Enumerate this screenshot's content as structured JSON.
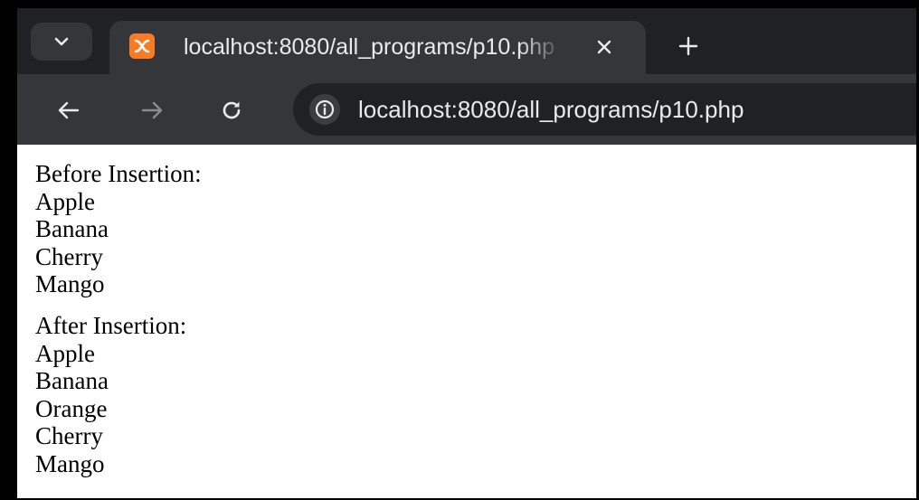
{
  "browser": {
    "tab": {
      "title": "localhost:8080/all_programs/p10.php",
      "favicon": "xampp-icon",
      "favicon_color": "#fb7a24"
    },
    "toolbar": {
      "url": "localhost:8080/all_programs/p10.php"
    },
    "colors": {
      "tabstrip_bg": "#202124",
      "toolbar_bg": "#35363a",
      "text": "#e8eaed"
    }
  },
  "page": {
    "before_heading": "Before Insertion:",
    "before_items": [
      "Apple",
      "Banana",
      "Cherry",
      "Mango"
    ],
    "after_heading": "After Insertion:",
    "after_items": [
      "Apple",
      "Banana",
      "Orange",
      "Cherry",
      "Mango"
    ]
  }
}
